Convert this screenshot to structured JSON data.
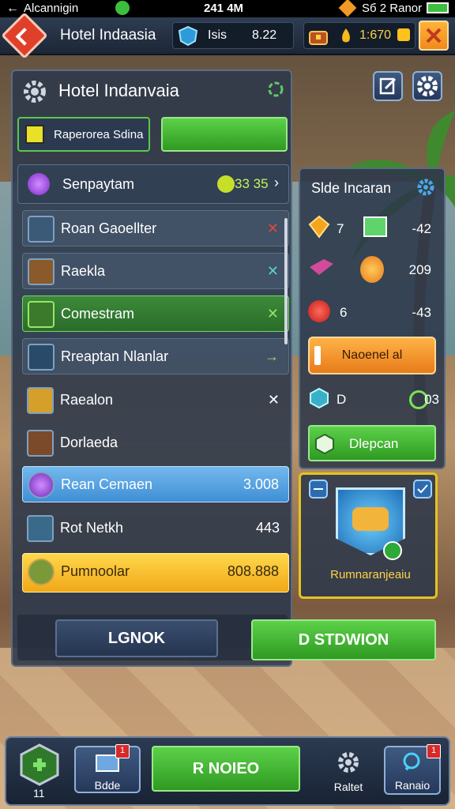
{
  "status_bar": {
    "left_text": "Alcannigin",
    "time": "241 4M",
    "right_text": "Sб 2 Rаnor"
  },
  "top_bar": {
    "title": "Hotel Indaasia",
    "res1_label": "Isis",
    "res1_value": "8.22",
    "res2_value": "1:670"
  },
  "main_panel": {
    "title": "Hotel Indanvaia",
    "name_field_value": "Raperorea Sdina",
    "resource_row": {
      "label": "Senpaytam",
      "value": "33 35"
    },
    "rows": [
      {
        "label": "Roan Gaoellter",
        "value": "",
        "action": "✕",
        "action_color": "#e34a3a"
      },
      {
        "label": "Raekla",
        "value": "",
        "action": "✕",
        "action_color": "#58d4c9"
      },
      {
        "label": "Comestram",
        "value": "",
        "action": "✕",
        "action_color": "#9ae36a"
      },
      {
        "label": "Rreaptan Nlanlar",
        "value": "",
        "action": "→",
        "action_color": "#9ae36a"
      },
      {
        "label": "Raealon",
        "value": "",
        "action": "✕",
        "action_color": "#ffffff"
      },
      {
        "label": "Dorlaeda",
        "value": "",
        "action": "",
        "action_color": "#ffffff"
      },
      {
        "label": "Rean Cemaen",
        "value": "3.008",
        "action": "",
        "action_color": "#ffffff"
      },
      {
        "label": "Rot Netkh",
        "value": "443",
        "action": "",
        "action_color": "#ffffff"
      },
      {
        "label": "Pumnoolar",
        "value": "808.888",
        "action": "",
        "action_color": "#ffffff"
      }
    ],
    "left_button": "LGNOK",
    "right_button": "D STDWION"
  },
  "side_panel": {
    "title": "Slde Incaran",
    "items": [
      {
        "left": "7",
        "right": "-42"
      },
      {
        "left": "",
        "right": "209"
      },
      {
        "left": "6",
        "right": "-43"
      }
    ],
    "orange_button": "Naoenel al",
    "d_row": {
      "left": "D",
      "right": "03"
    },
    "green_button": "Dlepcan"
  },
  "reward_card": {
    "label": "Rumnaranjeaiu"
  },
  "bottom_nav": {
    "level": "11",
    "slot1_label": "Bdde",
    "slot1_badge": "1",
    "center_button": "R NOIEO",
    "settings_label": "Raltet",
    "search_label": "Ranaio",
    "search_badge": "1"
  },
  "colors": {
    "accent_green": "#3fb52e",
    "accent_orange": "#f08a1c",
    "panel": "#2c384a",
    "highlight_blue": "#5aa7e2",
    "highlight_gold": "#f2c21a"
  }
}
